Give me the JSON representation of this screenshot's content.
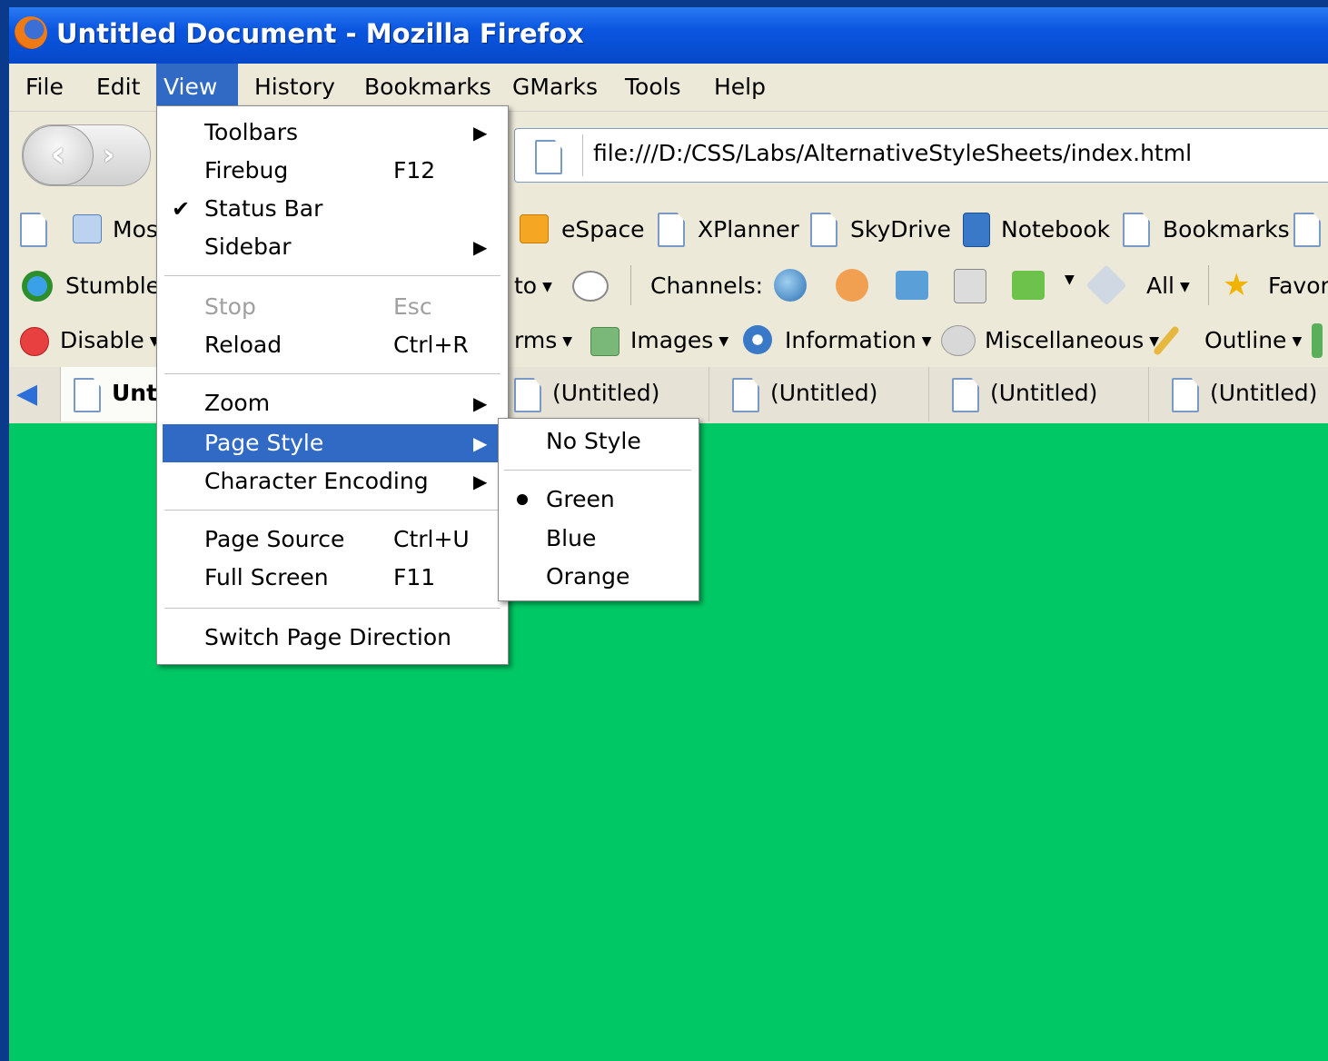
{
  "window": {
    "title": "Untitled Document - Mozilla Firefox"
  },
  "menubar": {
    "items": [
      {
        "label": "File"
      },
      {
        "label": "Edit"
      },
      {
        "label": "View"
      },
      {
        "label": "History"
      },
      {
        "label": "Bookmarks"
      },
      {
        "label": "GMarks"
      },
      {
        "label": "Tools"
      },
      {
        "label": "Help"
      }
    ]
  },
  "navigation": {
    "url": "file:///D:/CSS/Labs/AlternativeStyleSheets/index.html"
  },
  "bookmarks_toolbar": {
    "items": [
      {
        "label": "Mos"
      },
      {
        "label": "eSpace"
      },
      {
        "label": "XPlanner"
      },
      {
        "label": "SkyDrive"
      },
      {
        "label": "Notebook"
      },
      {
        "label": "Bookmarks"
      }
    ]
  },
  "stumble_toolbar": {
    "stumble": "Stumble!",
    "to": "to",
    "channels": "Channels:",
    "all": "All",
    "favorites": "Favor"
  },
  "webdev_toolbar": {
    "disable": "Disable",
    "forms": "rms",
    "images": "Images",
    "information": "Information",
    "miscellaneous": "Miscellaneous",
    "outline": "Outline"
  },
  "tabs": [
    {
      "label": "Unt"
    },
    {
      "label": "(Untitled)"
    },
    {
      "label": "(Untitled)"
    },
    {
      "label": "(Untitled)"
    },
    {
      "label": "(Untitled)"
    }
  ],
  "view_menu": {
    "toolbars": "Toolbars",
    "firebug": "Firebug",
    "firebug_shortcut": "F12",
    "status_bar": "Status Bar",
    "sidebar": "Sidebar",
    "stop": "Stop",
    "stop_shortcut": "Esc",
    "reload": "Reload",
    "reload_shortcut": "Ctrl+R",
    "zoom": "Zoom",
    "page_style": "Page Style",
    "character_encoding": "Character Encoding",
    "page_source": "Page Source",
    "page_source_shortcut": "Ctrl+U",
    "full_screen": "Full Screen",
    "full_screen_shortcut": "F11",
    "switch_page_direction": "Switch Page Direction"
  },
  "page_style_menu": {
    "no_style": "No Style",
    "green": "Green",
    "blue": "Blue",
    "orange": "Orange",
    "selected": "Green"
  },
  "colors": {
    "page_background": "#00c864",
    "menu_highlight": "#316ac5",
    "titlebar": "#0a56e0",
    "desktop": "#0a3a8c"
  }
}
